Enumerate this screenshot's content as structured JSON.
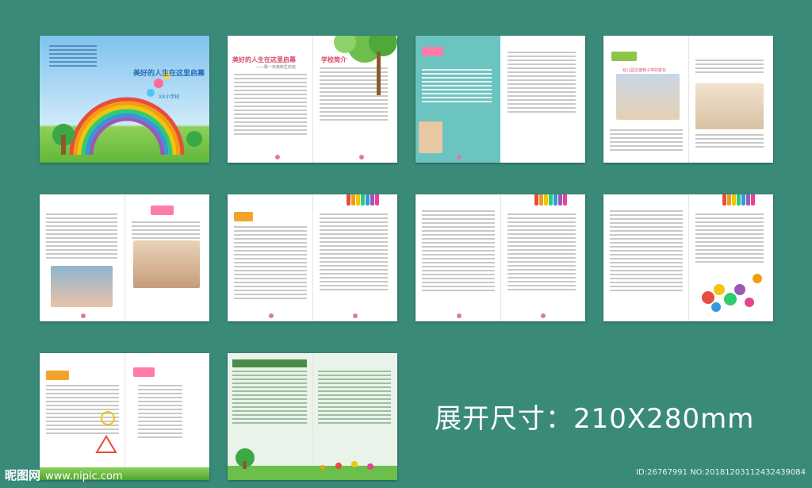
{
  "cover": {
    "title": "美好的人生在这里启幕",
    "school": "XX小学校"
  },
  "spread2": {
    "left_title": "美好的人生在这里启幕",
    "left_subtitle": "——致一年级新生的信",
    "right_title": "学校简介"
  },
  "spread4": {
    "subtitle": "幼儿园过渡到小学的变化"
  },
  "caption": "展开尺寸：210X280mm",
  "watermark": {
    "logo": "昵图网",
    "url": "www.nipic.com",
    "id": "ID:26767991 NO:20181203112432439084"
  }
}
